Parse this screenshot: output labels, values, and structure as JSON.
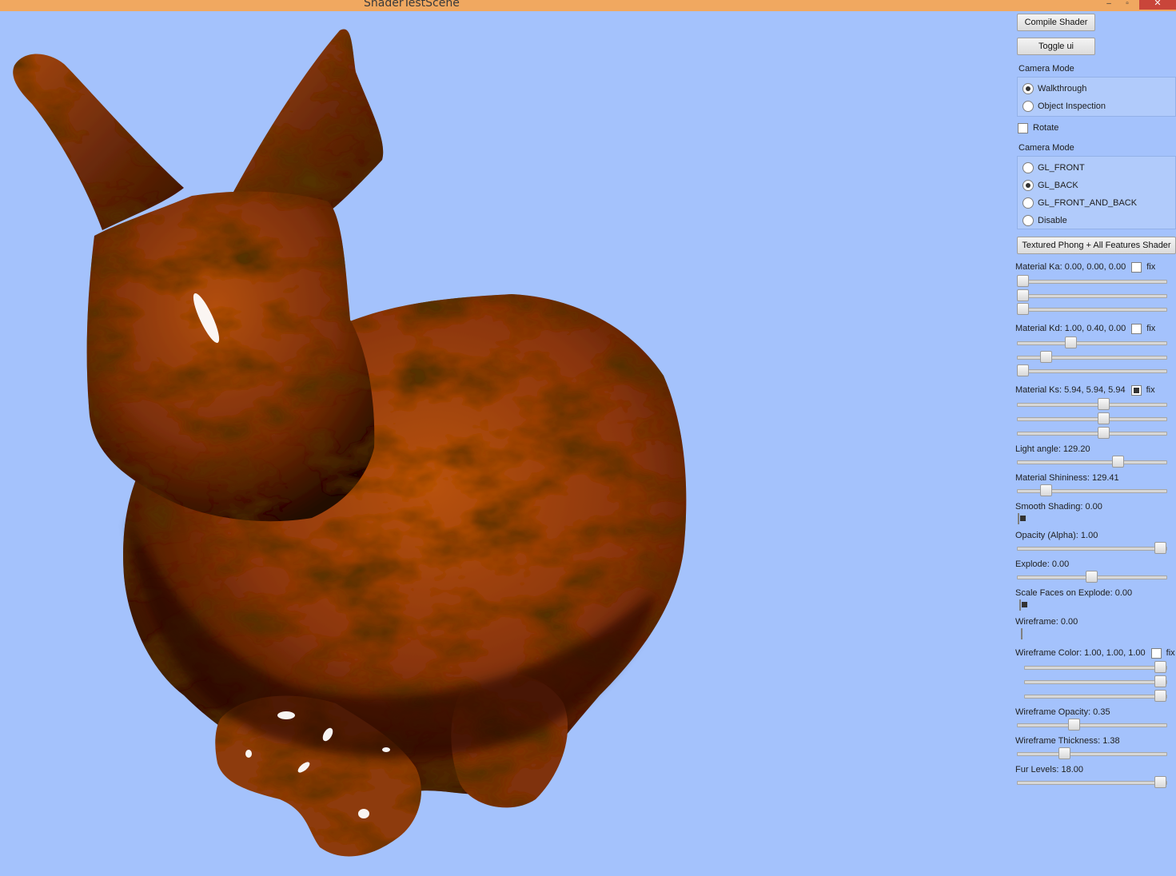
{
  "window": {
    "title": "ShaderTestScene",
    "minimize_glyph": "‒",
    "maximize_glyph": "▫",
    "close_glyph": "✕"
  },
  "colors": {
    "background": "#a4c2fc",
    "titlebar": "#f0a860",
    "close": "#c9453a",
    "model": "#a6460f"
  },
  "viewport": {
    "model": "stanford-bunny",
    "icon": "bunny-model"
  },
  "panel": {
    "compile_button": "Compile Shader",
    "toggle_ui_button": "Toggle ui",
    "camera_mode_label": "Camera Mode",
    "camera_modes": [
      {
        "label": "Walkthrough",
        "checked": true
      },
      {
        "label": "Object Inspection",
        "checked": false
      }
    ],
    "rotate_label": "Rotate",
    "rotate_checked": false,
    "cull_mode_label": "Camera Mode",
    "cull_modes": [
      {
        "label": "GL_FRONT",
        "checked": false
      },
      {
        "label": "GL_BACK",
        "checked": true
      },
      {
        "label": "GL_FRONT_AND_BACK",
        "checked": false
      },
      {
        "label": "Disable",
        "checked": false
      }
    ],
    "shader_button": "Textured Phong + All Features Shader",
    "fix_label": "fix",
    "material_ka": {
      "label": "Material Ka: 0.00, 0.00, 0.00",
      "fix": false,
      "values": [
        0,
        0,
        0
      ]
    },
    "material_kd": {
      "label": "Material Kd: 1.00, 0.40, 0.00",
      "fix": false,
      "values": [
        0.35,
        0.17,
        0
      ]
    },
    "material_ks": {
      "label": "Material Ks: 5.94, 5.94, 5.94",
      "fix": true,
      "values": [
        0.59,
        0.59,
        0.59
      ]
    },
    "light_angle": {
      "label": "Light angle: 129.20",
      "value": 0.69
    },
    "material_shininess": {
      "label": "Material Shininess: 129.41",
      "value": 0.17
    },
    "smooth_shading": {
      "label": "Smooth Shading: 0.00",
      "checked": true
    },
    "opacity": {
      "label": "Opacity (Alpha): 1.00",
      "value": 1.0
    },
    "explode": {
      "label": "Explode: 0.00",
      "value": 0.5
    },
    "scale_faces": {
      "label": "Scale Faces on Explode: 0.00",
      "checked": true
    },
    "wireframe": {
      "label": "Wireframe: 0.00",
      "checked": false
    },
    "wireframe_color": {
      "label": "Wireframe Color: 1.00, 1.00, 1.00",
      "fix": false,
      "values": [
        1,
        1,
        1
      ]
    },
    "wireframe_opacity": {
      "label": "Wireframe Opacity: 0.35",
      "value": 0.37
    },
    "wireframe_thickness": {
      "label": "Wireframe Thickness: 1.38",
      "value": 0.3
    },
    "fur_levels": {
      "label": "Fur Levels: 18.00",
      "value": 1.0
    }
  }
}
